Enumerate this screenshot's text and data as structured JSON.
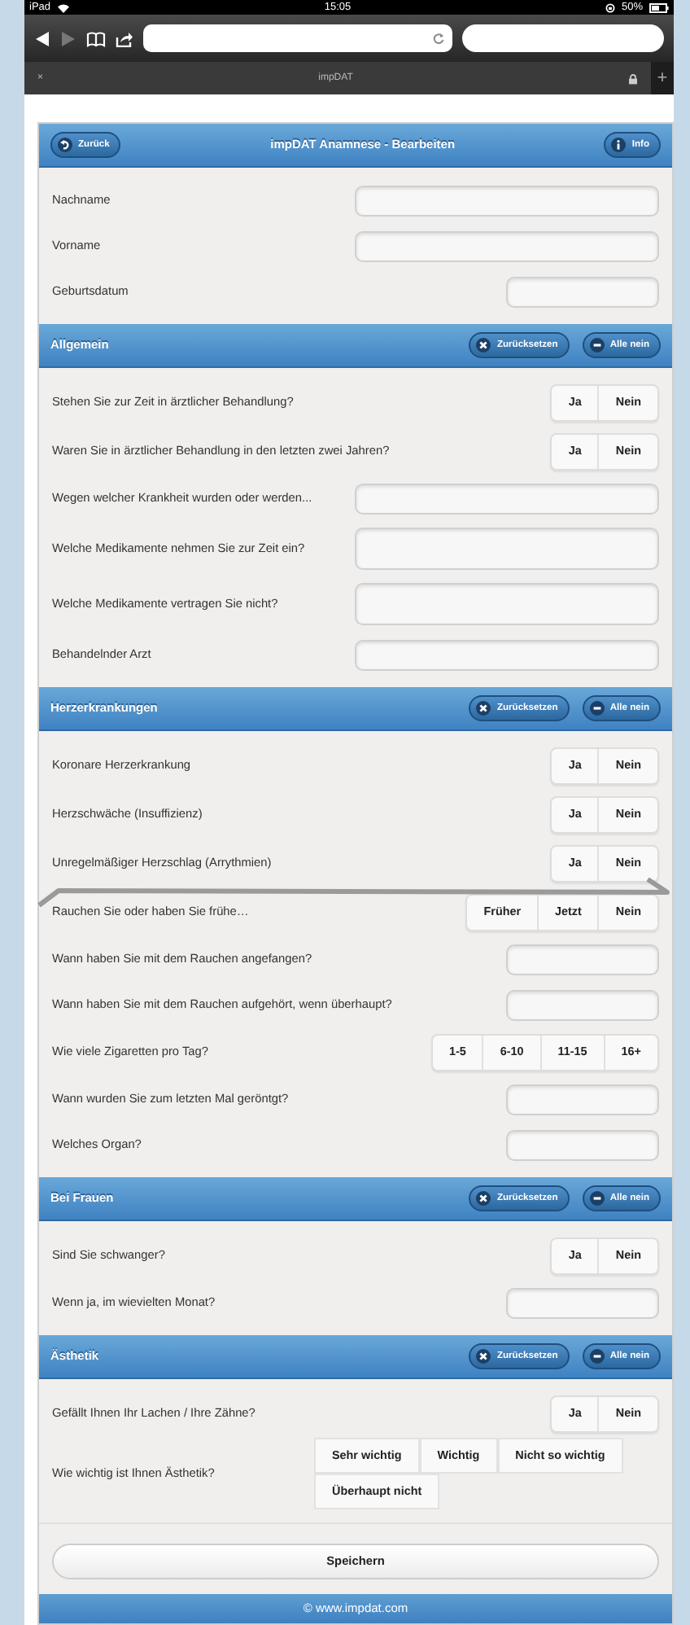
{
  "status_bar": {
    "device": "iPad",
    "time": "15:05",
    "battery": "50%"
  },
  "browser": {
    "tab_close": "×",
    "tab_title": "impDAT",
    "new_tab": "+"
  },
  "header": {
    "back": "Zurück",
    "title": "impDAT Anamnese - Bearbeiten",
    "info": "Info"
  },
  "personal": {
    "items": [
      {
        "kind": "text",
        "label": "Nachname"
      },
      {
        "kind": "text",
        "label": "Vorname"
      },
      {
        "kind": "short",
        "label": "Geburtsdatum"
      }
    ]
  },
  "sections": [
    {
      "title": "Allgemein",
      "reset": "Zurücksetzen",
      "all_no": "Alle nein",
      "items": [
        {
          "kind": "choice",
          "label": "Stehen Sie zur Zeit in ärztlicher Behandlung?",
          "options": [
            {
              "label": "Ja",
              "selected": false
            },
            {
              "label": "Nein",
              "selected": false
            }
          ]
        },
        {
          "kind": "choice",
          "label": "Waren Sie in ärztlicher Behandlung in den letzten zwei Jahren?",
          "options": [
            {
              "label": "Ja",
              "selected": false
            },
            {
              "label": "Nein",
              "selected": false
            }
          ]
        },
        {
          "kind": "text",
          "label": "Wegen welcher Krankheit wurden oder werden..."
        },
        {
          "kind": "area",
          "label": "Welche Medikamente nehmen Sie zur Zeit ein?"
        },
        {
          "kind": "area",
          "label": "Welche Medikamente vertragen Sie nicht?"
        },
        {
          "kind": "text",
          "label": "Behandelnder Arzt"
        }
      ]
    },
    {
      "title": "Herzerkrankungen",
      "reset": "Zurücksetzen",
      "all_no": "Alle nein",
      "items": [
        {
          "kind": "choice",
          "label": "Koronare Herzerkrankung",
          "options": [
            {
              "label": "Ja",
              "selected": false
            },
            {
              "label": "Nein",
              "selected": false
            }
          ]
        },
        {
          "kind": "choice",
          "label": "Herzschwäche (Insuffizienz)",
          "options": [
            {
              "label": "Ja",
              "selected": false
            },
            {
              "label": "Nein",
              "selected": false
            }
          ]
        },
        {
          "kind": "choice",
          "label": "Unregelmäßiger Herzschlag (Arrythmien)",
          "options": [
            {
              "label": "Ja",
              "selected": false
            },
            {
              "label": "Nein",
              "selected": false
            }
          ]
        },
        {
          "kind": "choice",
          "label": "Rauchen Sie oder haben Sie frühe…",
          "options": [
            {
              "label": "Früher",
              "selected": false
            },
            {
              "label": "Jetzt",
              "selected": false
            },
            {
              "label": "Nein",
              "selected": false
            }
          ]
        },
        {
          "kind": "short",
          "label": "Wann haben Sie mit dem Rauchen angefangen?"
        },
        {
          "kind": "short",
          "label": "Wann haben Sie mit dem Rauchen aufgehört, wenn überhaupt?"
        },
        {
          "kind": "choice",
          "label": "Wie viele Zigaretten pro Tag?",
          "options": [
            {
              "label": "1-5",
              "selected": false
            },
            {
              "label": "6-10",
              "selected": false
            },
            {
              "label": "11-15",
              "selected": false
            },
            {
              "label": "16+",
              "selected": false
            }
          ]
        },
        {
          "kind": "short",
          "label": "Wann wurden Sie zum letzten Mal geröntgt?"
        },
        {
          "kind": "short",
          "label": "Welches Organ?"
        }
      ]
    },
    {
      "title": "Bei Frauen",
      "reset": "Zurücksetzen",
      "all_no": "Alle nein",
      "items": [
        {
          "kind": "choice",
          "label": "Sind Sie schwanger?",
          "options": [
            {
              "label": "Ja",
              "selected": false
            },
            {
              "label": "Nein",
              "selected": false
            }
          ]
        },
        {
          "kind": "short",
          "label": "Wenn ja, im wievielten Monat?"
        }
      ]
    },
    {
      "title": "Ästhetik",
      "reset": "Zurücksetzen",
      "all_no": "Alle nein",
      "items": [
        {
          "kind": "choice",
          "label": "Gefällt Ihnen Ihr Lachen / Ihre Zähne?",
          "options": [
            {
              "label": "Ja",
              "selected": false
            },
            {
              "label": "Nein",
              "selected": false
            }
          ]
        },
        {
          "kind": "wrapchoice",
          "label": "Wie wichtig ist Ihnen Ästhetik?",
          "options": [
            {
              "label": "Sehr wichtig",
              "selected": false
            },
            {
              "label": "Wichtig",
              "selected": false
            },
            {
              "label": "Nicht so wichtig",
              "selected": false
            },
            {
              "label": "Überhaupt nicht",
              "selected": false
            }
          ]
        }
      ]
    }
  ],
  "save": "Speichern",
  "footer": "© www.impdat.com"
}
